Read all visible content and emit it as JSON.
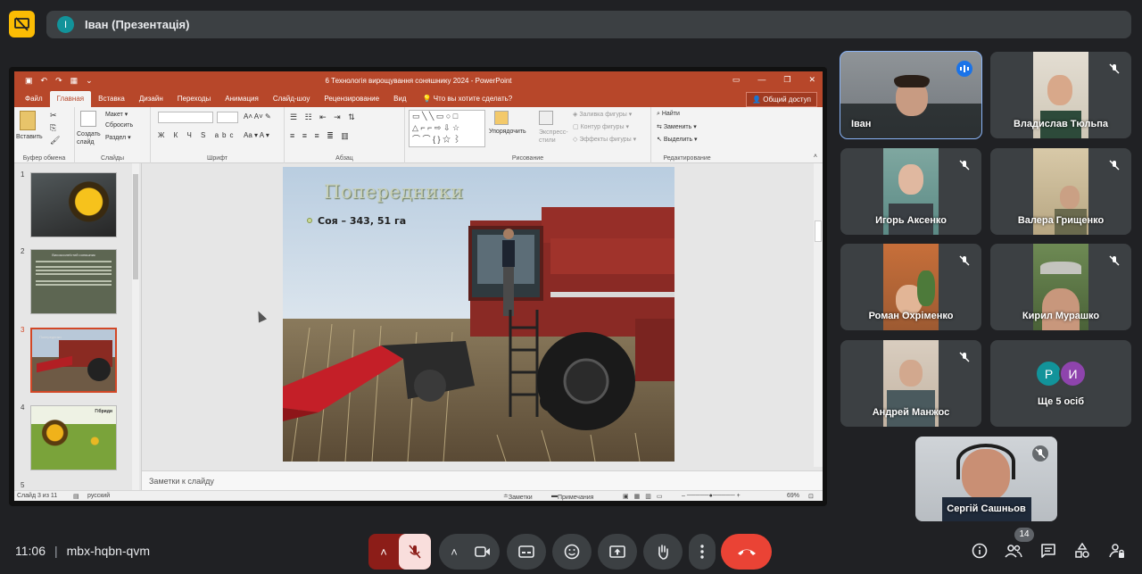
{
  "header": {
    "presenter_initial": "І",
    "presentation_title": "Іван (Презентація)"
  },
  "powerpoint": {
    "window_title": "6 Технологія вирощування соняшнику 2024 - PowerPoint",
    "tabs": [
      "Файл",
      "Главная",
      "Вставка",
      "Дизайн",
      "Переходы",
      "Анимация",
      "Слайд-шоу",
      "Рецензирование",
      "Вид"
    ],
    "active_tab": "Главная",
    "tell_me": "Что вы хотите сделать?",
    "share": "Общий доступ",
    "ribbon": {
      "paste": "Вставить",
      "clipboard": "Буфер обмена",
      "new_slide": "Создать слайд",
      "layout": "Макет",
      "reset": "Сбросить",
      "section": "Раздел",
      "slides": "Слайды",
      "font": "Шрифт",
      "paragraph": "Абзац",
      "arrange": "Упорядочить",
      "quick_styles": "Экспресс-стили",
      "shape_fill": "Заливка фигуры",
      "shape_outline": "Контур фигуры",
      "shape_effects": "Эффекты фигуры",
      "drawing": "Рисование",
      "find": "Найти",
      "replace": "Заменить",
      "select": "Выделить",
      "editing": "Редактирование"
    },
    "thumbnails": [
      {
        "num": "1"
      },
      {
        "num": "2",
        "heading": "Високоолеїстий соняшник"
      },
      {
        "num": "3",
        "caption": "Попередники"
      },
      {
        "num": "4",
        "caption": "Гібриди"
      },
      {
        "num": "5"
      }
    ],
    "slide": {
      "title": "Попередники",
      "bullet": "Соя – 343, 51 га"
    },
    "notes_placeholder": "Заметки к слайду",
    "status": {
      "slide_of": "Слайд 3 из 11",
      "language": "русский",
      "notes": "Заметки",
      "comments": "Примечания",
      "zoom": "69%"
    }
  },
  "participants": [
    {
      "name": "Іван",
      "speaking": true
    },
    {
      "name": "Владислав Тюльпа",
      "muted": true
    },
    {
      "name": "Игорь Аксенко",
      "muted": true
    },
    {
      "name": "Валера Грищенко",
      "muted": true
    },
    {
      "name": "Роман Охріменко",
      "muted": true
    },
    {
      "name": "Кирил Мурашко",
      "muted": true
    },
    {
      "name": "Андрей Манжос",
      "muted": true
    },
    {
      "name": "Ще 5 осіб",
      "avatars": [
        "Р",
        "И"
      ]
    }
  ],
  "self_view": {
    "name": "Сергій Сашньов",
    "muted": true
  },
  "meeting": {
    "time": "11:06",
    "code": "mbx-hqbn-qvm",
    "participant_count": "14"
  },
  "colors": {
    "accent_blue": "#8ab4f8",
    "end_call_red": "#ea4335",
    "ppt_orange": "#b7472a",
    "presenter_avatar": "#12939a",
    "logo_yellow": "#fbbc04"
  }
}
